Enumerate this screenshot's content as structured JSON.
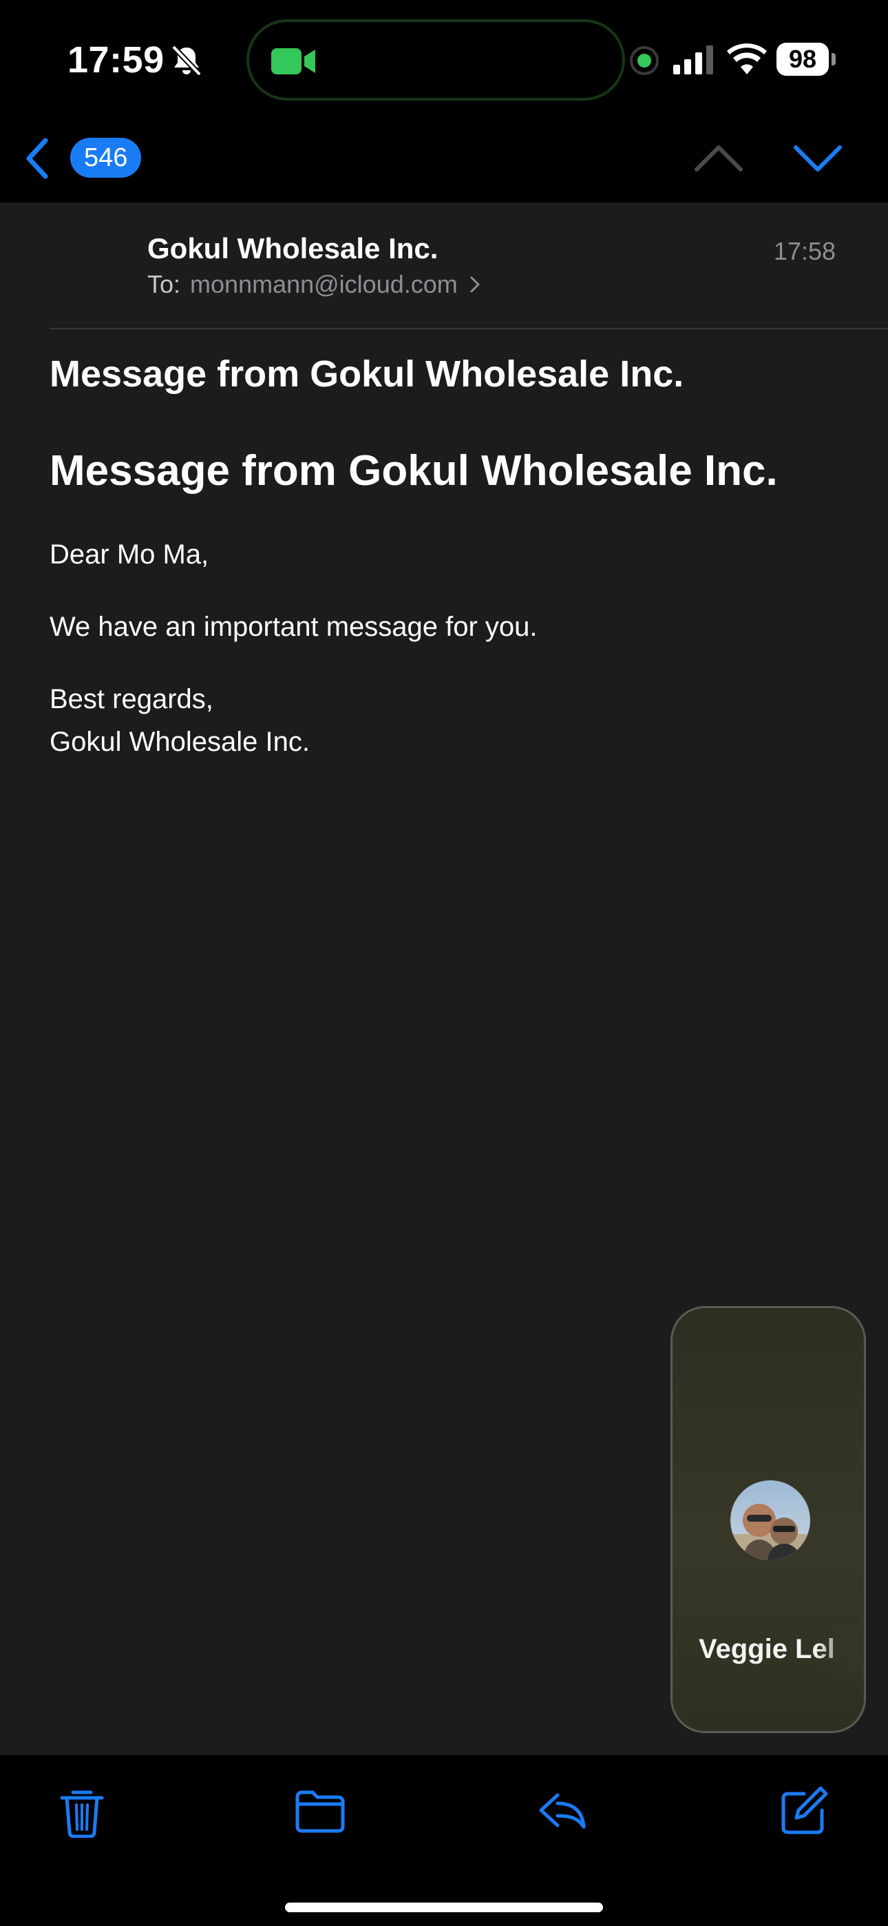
{
  "status_bar": {
    "time": "17:59",
    "battery": "98"
  },
  "nav": {
    "unread_count": "546"
  },
  "message": {
    "sender": "Gokul Wholesale Inc.",
    "to_label": "To:",
    "to_address": "monnmann@icloud.com",
    "time": "17:58",
    "subject": "Message from Gokul Wholesale Inc.",
    "body_heading": "Message from Gokul Wholesale Inc.",
    "greeting": "Dear Mo Ma,",
    "paragraph": "We have an important message for you.",
    "closing": "Best regards,",
    "signature": "Gokul Wholesale Inc."
  },
  "pip": {
    "caller_name": "Veggie Lel"
  },
  "colors": {
    "accent": "#1a7cf4",
    "facetime_green": "#34c759",
    "background": "#1c1c1e"
  },
  "icons": {
    "toolbar": [
      "trash-icon",
      "folder-icon",
      "reply-icon",
      "compose-icon"
    ]
  }
}
